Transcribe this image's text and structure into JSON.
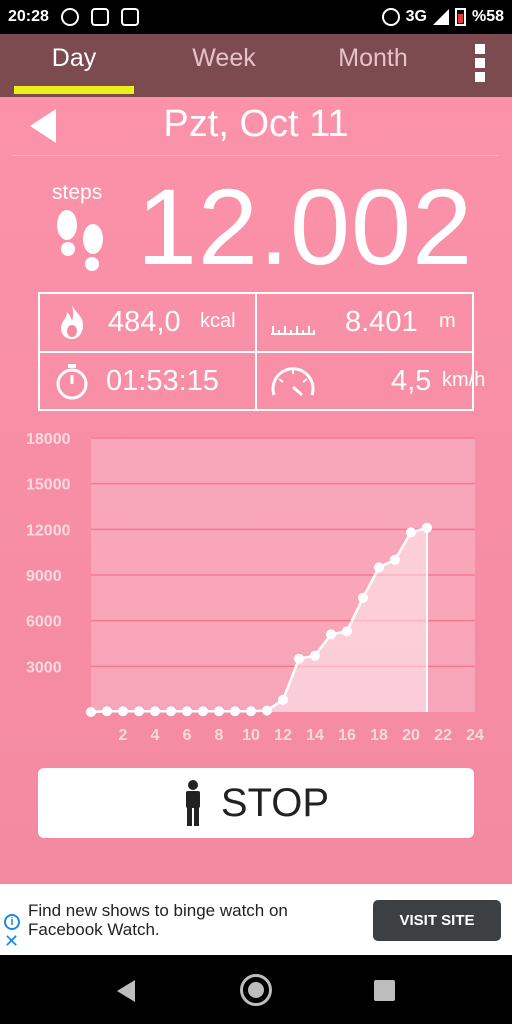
{
  "status_bar": {
    "time": "20:28",
    "network": "3G",
    "battery": "%58"
  },
  "tabs": [
    {
      "label": "Day",
      "active": true
    },
    {
      "label": "Week",
      "active": false
    },
    {
      "label": "Month",
      "active": false
    }
  ],
  "header": {
    "date": "Pzt, Oct 11"
  },
  "steps": {
    "label": "steps",
    "value": "12.002"
  },
  "stats": {
    "calories": {
      "value": "484,0",
      "unit": "kcal"
    },
    "distance": {
      "value": "8.401",
      "unit": "m"
    },
    "duration": {
      "value": "01:53:15"
    },
    "speed": {
      "value": "4,5",
      "unit": "km/h"
    }
  },
  "chart_data": {
    "type": "area",
    "x": [
      0,
      1,
      2,
      3,
      4,
      5,
      6,
      7,
      8,
      9,
      10,
      11,
      12,
      13,
      14,
      15,
      16,
      17,
      18,
      19,
      20,
      21
    ],
    "values": [
      0,
      50,
      50,
      50,
      50,
      50,
      50,
      50,
      50,
      50,
      50,
      100,
      800,
      3500,
      3700,
      5100,
      5300,
      7500,
      9500,
      10000,
      11800,
      12100
    ],
    "x_ticks": [
      "2",
      "4",
      "6",
      "8",
      "10",
      "12",
      "14",
      "16",
      "18",
      "20",
      "22",
      "24"
    ],
    "y_ticks": [
      "3000",
      "6000",
      "9000",
      "12000",
      "15000",
      "18000"
    ],
    "xlim": [
      0,
      24
    ],
    "ylim": [
      0,
      18000
    ],
    "grid": true
  },
  "stop_button": {
    "label": "STOP"
  },
  "ad": {
    "text": "Find new shows to binge watch on Facebook Watch.",
    "cta": "VISIT SITE",
    "info_glyph": "i",
    "close_glyph": "✕"
  },
  "colors": {
    "background": "#f38aa2",
    "app_bar": "#7b4b50",
    "tab_indicator": "#e9f21a",
    "foreground": "#ffffff"
  }
}
